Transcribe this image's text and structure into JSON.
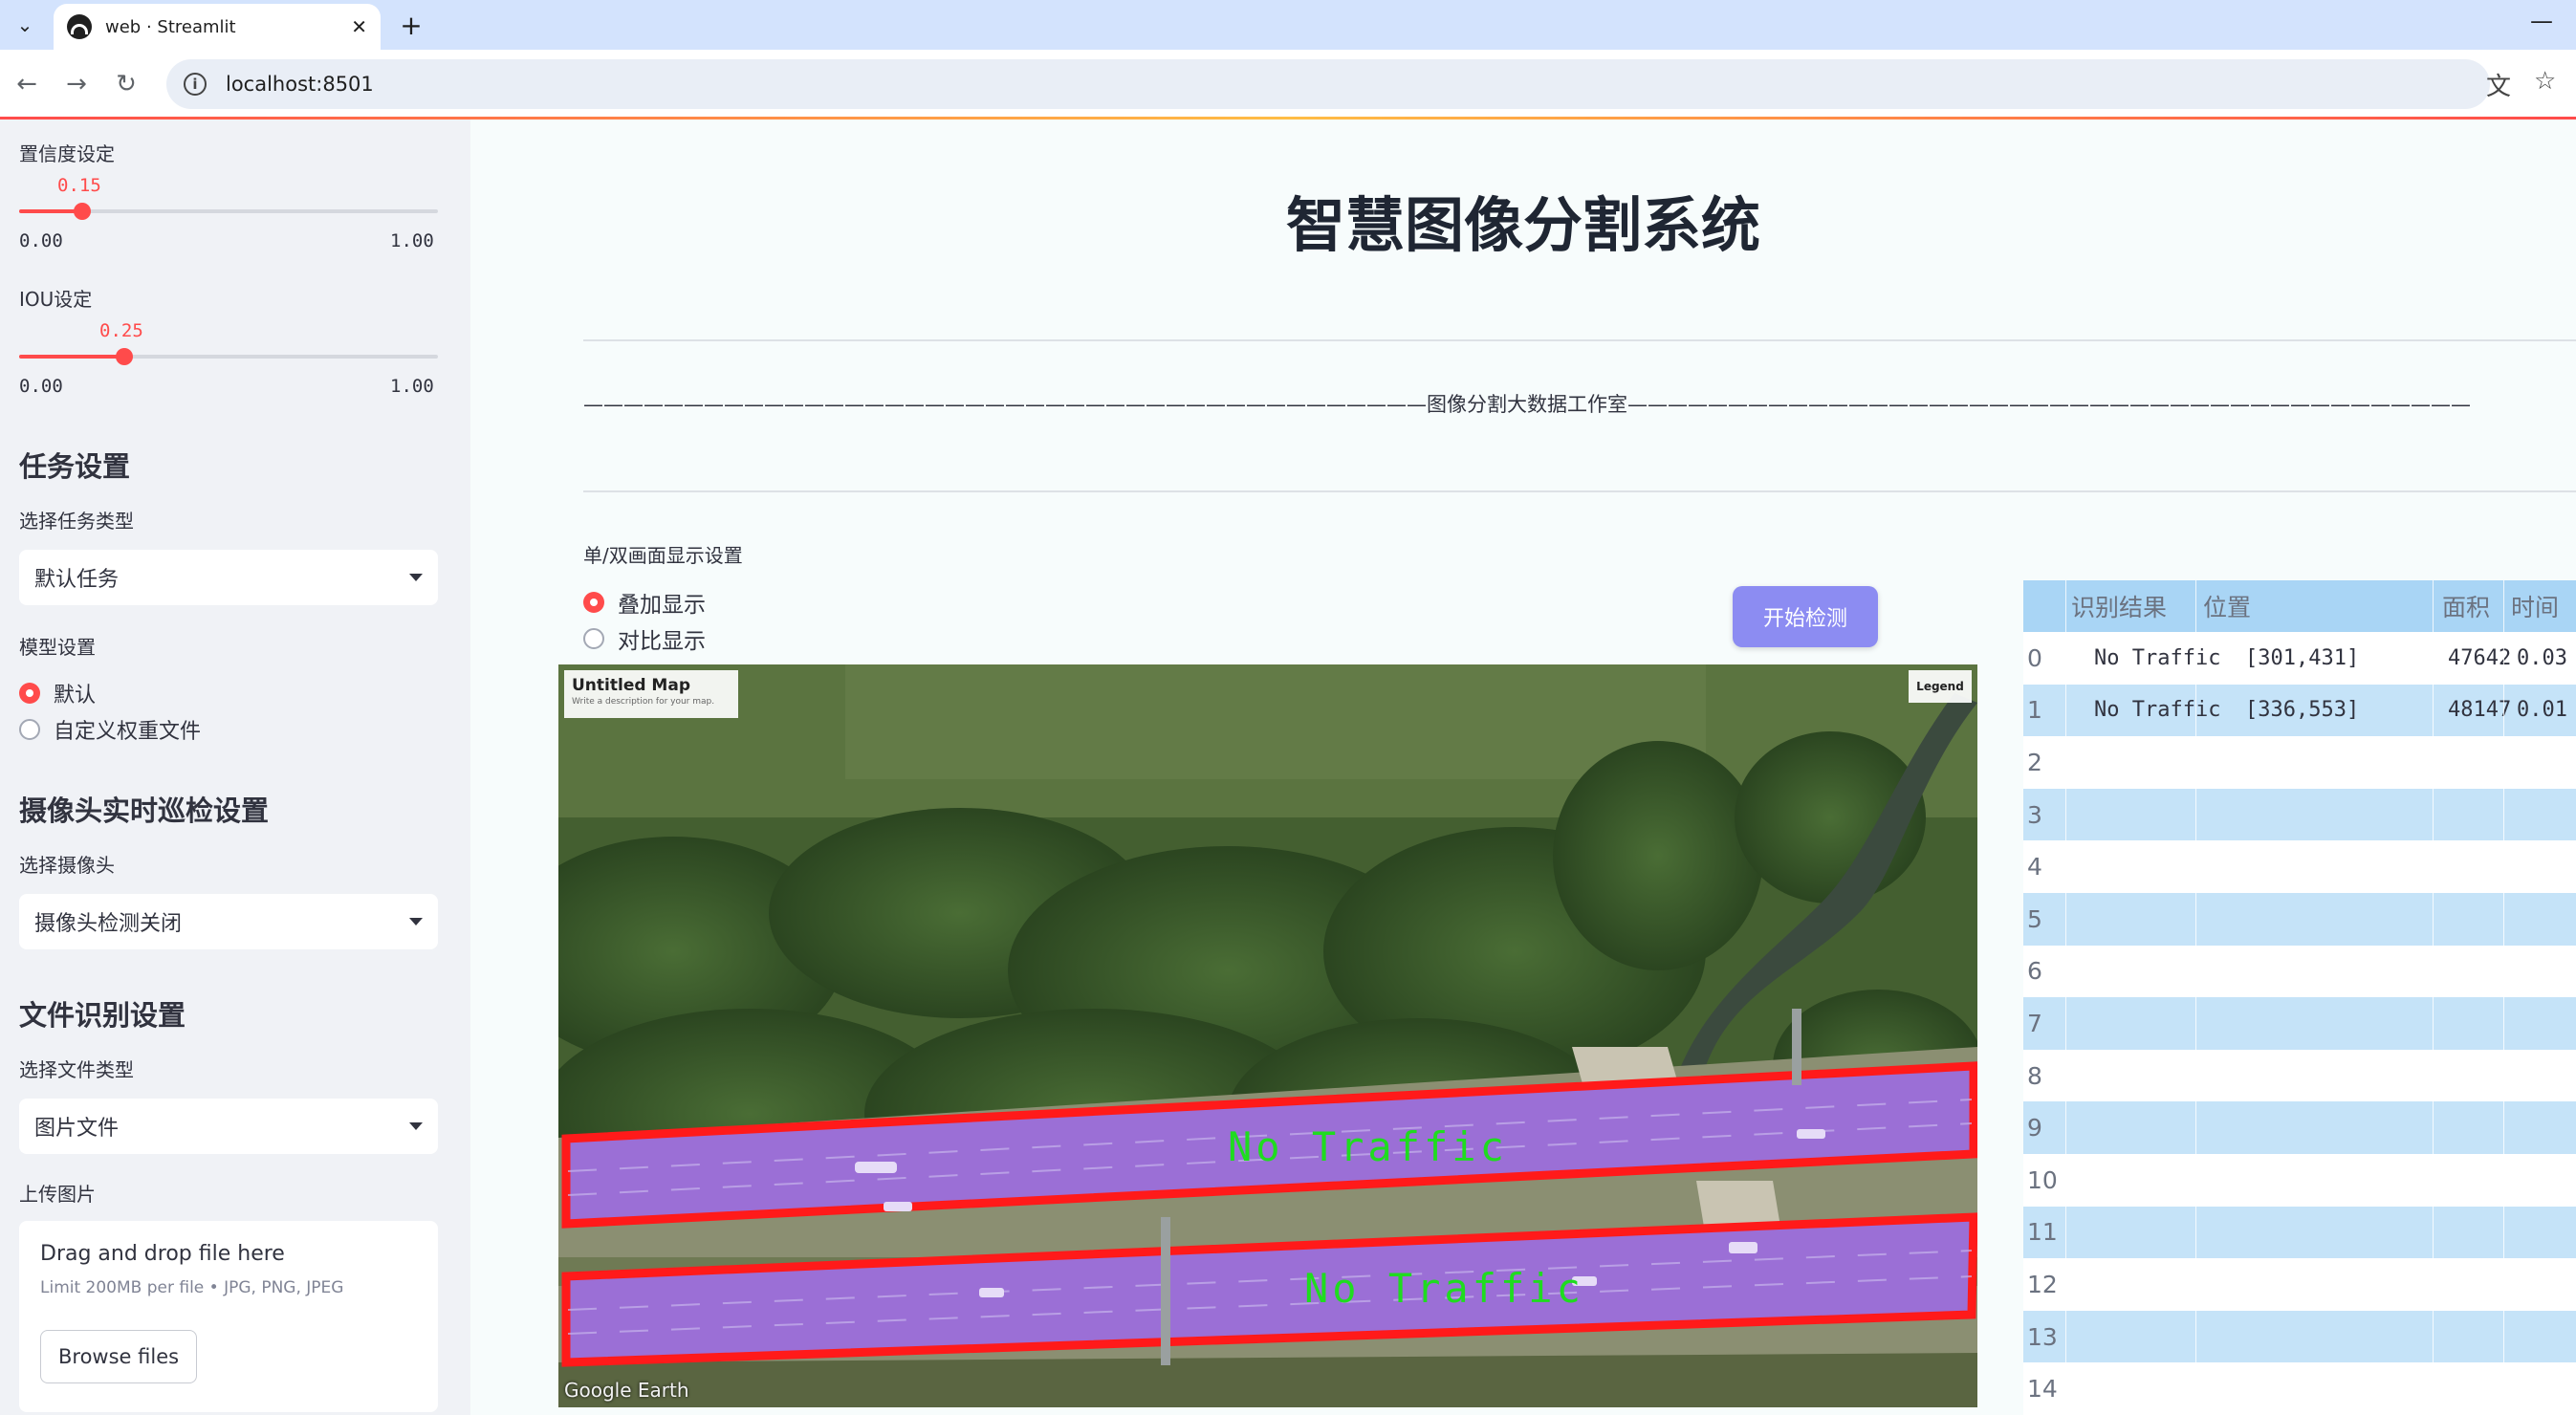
{
  "browser": {
    "tab_title": "web · Streamlit",
    "url": "localhost:8501"
  },
  "sidebar": {
    "confidence": {
      "label": "置信度设定",
      "value": "0.15",
      "min": "0.00",
      "max": "1.00",
      "fraction": 0.15
    },
    "iou": {
      "label": "IOU设定",
      "value": "0.25",
      "min": "0.00",
      "max": "1.00",
      "fraction": 0.25
    },
    "task": {
      "header": "任务设置",
      "select_label": "选择任务类型",
      "selected": "默认任务"
    },
    "model": {
      "label": "模型设置",
      "options": [
        "默认",
        "自定义权重文件"
      ],
      "selected_index": 0
    },
    "camera": {
      "header": "摄像头实时巡检设置",
      "select_label": "选择摄像头",
      "selected": "摄像头检测关闭"
    },
    "file": {
      "header": "文件识别设置",
      "select_label": "选择文件类型",
      "selected": "图片文件"
    },
    "upload": {
      "label": "上传图片",
      "drag_text": "Drag and drop file here",
      "limit_text": "Limit 200MB per file • JPG, PNG, JPEG",
      "browse_label": "Browse files"
    }
  },
  "main": {
    "title": "智慧图像分割系统",
    "divider_text": "——————————————————————————————————————————图像分割大数据工作室——————————————————————————————————————————",
    "display": {
      "label": "单/双画面显示设置",
      "options": [
        "叠加显示",
        "对比显示"
      ],
      "selected_index": 0
    },
    "start_button": "开始检测",
    "image": {
      "map_title": "Untitled Map",
      "map_subtitle": "Write a description for your map.",
      "legend": "Legend",
      "watermark": "Google Earth",
      "segment_labels": [
        "No  Traffic",
        "No  Traffic"
      ]
    },
    "table": {
      "headers": [
        "识别结果",
        "位置",
        "面积",
        "时间"
      ],
      "rows": [
        {
          "index": "0",
          "result": "No Traffic",
          "position": "[301,431]",
          "area": "47642",
          "time": "0.03"
        },
        {
          "index": "1",
          "result": "No Traffic",
          "position": "[336,553]",
          "area": "48147",
          "time": "0.01"
        },
        {
          "index": "2",
          "result": "",
          "position": "",
          "area": "",
          "time": ""
        },
        {
          "index": "3",
          "result": "",
          "position": "",
          "area": "",
          "time": ""
        },
        {
          "index": "4",
          "result": "",
          "position": "",
          "area": "",
          "time": ""
        },
        {
          "index": "5",
          "result": "",
          "position": "",
          "area": "",
          "time": ""
        },
        {
          "index": "6",
          "result": "",
          "position": "",
          "area": "",
          "time": ""
        },
        {
          "index": "7",
          "result": "",
          "position": "",
          "area": "",
          "time": ""
        },
        {
          "index": "8",
          "result": "",
          "position": "",
          "area": "",
          "time": ""
        },
        {
          "index": "9",
          "result": "",
          "position": "",
          "area": "",
          "time": ""
        },
        {
          "index": "10",
          "result": "",
          "position": "",
          "area": "",
          "time": ""
        },
        {
          "index": "11",
          "result": "",
          "position": "",
          "area": "",
          "time": ""
        },
        {
          "index": "12",
          "result": "",
          "position": "",
          "area": "",
          "time": ""
        },
        {
          "index": "13",
          "result": "",
          "position": "",
          "area": "",
          "time": ""
        },
        {
          "index": "14",
          "result": "",
          "position": "",
          "area": "",
          "time": ""
        }
      ]
    }
  },
  "colors": {
    "accent": "#ff4b4b",
    "sidebar_bg": "#f0f2f6",
    "table_header": "#a9d5f5",
    "table_stripe": "#c5e3f8",
    "segment_fill": "#9b6fd6",
    "segment_outline": "#ff1a1a",
    "segment_text": "#1fdc1f",
    "start_button": "#8c8cf2"
  }
}
